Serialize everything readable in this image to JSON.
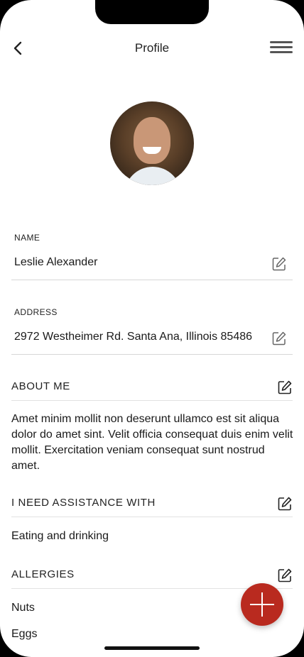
{
  "header": {
    "title": "Profile",
    "back_icon": "chevron-left-icon",
    "menu_icon": "hamburger-menu-icon"
  },
  "avatar": {
    "alt": "profile-photo"
  },
  "name": {
    "label": "NAME",
    "value": "Leslie Alexander"
  },
  "address": {
    "label": "ADDRESS",
    "value": "2972 Westheimer Rd. Santa Ana, Illinois 85486"
  },
  "about": {
    "title": "ABOUT ME",
    "text": "Amet minim mollit non deserunt ullamco est sit aliqua dolor do amet sint. Velit officia consequat duis enim velit mollit. Exercitation veniam consequat sunt nostrud amet."
  },
  "assistance": {
    "title": "I NEED ASSISTANCE WITH",
    "items": [
      "Eating and drinking"
    ]
  },
  "allergies": {
    "title": "ALLERGIES",
    "items": [
      "Nuts",
      "Eggs"
    ]
  },
  "fab": {
    "icon": "plus-icon",
    "color": "#b92a1f"
  }
}
